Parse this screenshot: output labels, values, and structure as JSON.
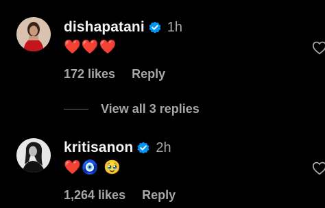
{
  "comments": [
    {
      "username": "dishapatani",
      "time": "1h",
      "text": "❤️❤️❤️",
      "likes": "172 likes",
      "reply": "Reply",
      "avatar_icon": "profile-photo-red-outfit",
      "verified_icon": "verified-badge-icon",
      "like_icon": "heart-outline-icon"
    },
    {
      "username": "kritisanon",
      "time": "2h",
      "text": "❤️🧿 🥹",
      "likes": "1,264 likes",
      "reply": "Reply",
      "avatar_icon": "profile-photo-monochrome",
      "verified_icon": "verified-badge-icon",
      "like_icon": "heart-outline-icon"
    }
  ],
  "view_replies": "View all 3 replies",
  "colors": {
    "background": "#000000",
    "primary_text": "#f5f5f5",
    "secondary_text": "#a8a8a8",
    "verified_blue": "#0095f6"
  }
}
